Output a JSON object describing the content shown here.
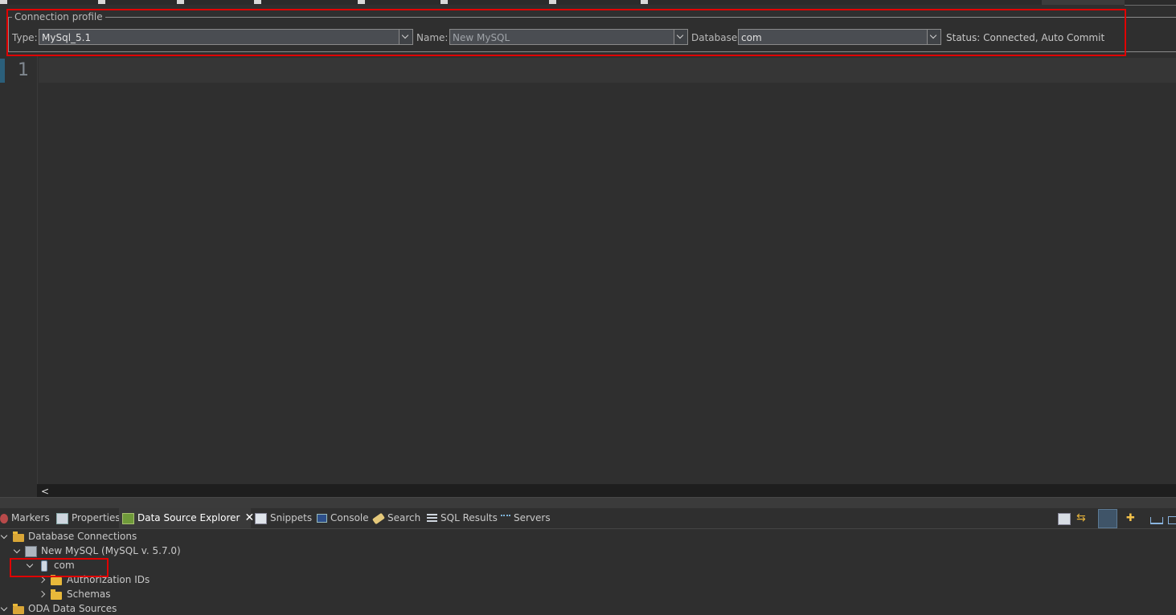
{
  "connection_profile": {
    "legend": "Connection profile",
    "type_label": "Type:",
    "type_value": "MySql_5.1",
    "name_label": "Name:",
    "name_value": "New MySQL",
    "database_label": "Database:",
    "database_value": "com",
    "status_text": "Status: Connected, Auto Commit"
  },
  "editor": {
    "line_numbers": [
      "1"
    ]
  },
  "views": {
    "tabs": [
      {
        "label": "Markers",
        "icon": "markers-icon"
      },
      {
        "label": "Properties",
        "icon": "properties-icon"
      },
      {
        "label": "Data Source Explorer",
        "icon": "data-source-explorer-icon",
        "active": true
      },
      {
        "label": "Snippets",
        "icon": "snippets-icon"
      },
      {
        "label": "Console",
        "icon": "console-icon"
      },
      {
        "label": "Search",
        "icon": "search-icon"
      },
      {
        "label": "SQL Results",
        "icon": "sql-results-icon"
      },
      {
        "label": "Servers",
        "icon": "servers-icon"
      }
    ],
    "toolbar_icons": [
      "collapse-all-icon",
      "link-with-editor-icon",
      "tree-layout-icon",
      "new-connection-icon",
      "minimize-icon",
      "maximize-icon"
    ]
  },
  "tree": {
    "database_connections": "Database Connections",
    "connection": "New MySQL (MySQL v. 5.7.0)",
    "database": "com",
    "authorization_ids": "Authorization IDs",
    "schemas": "Schemas",
    "oda_data_sources": "ODA Data Sources"
  },
  "colors": {
    "background": "#2f2f2f",
    "highlight_box": "#e00000",
    "folder": "#e8b83a"
  }
}
